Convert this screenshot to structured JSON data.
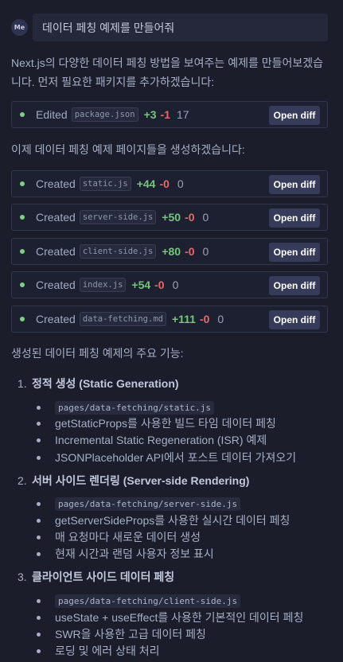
{
  "user": {
    "avatar": "Me",
    "message": "데이터 페칭 예제를 만들어줘"
  },
  "intro": "Next.js의 다양한 데이터 페칭 방법을 보여주는 예제를 만들어보겠습니다. 먼저 필요한 패키지를 추가하겠습니다:",
  "edit_card": {
    "verb": "Edited",
    "file": "package.json",
    "added": "+3",
    "removed": "-1",
    "count": "17",
    "button": "Open diff"
  },
  "create_intro": "이제 데이터 페칭 예제 페이지들을 생성하겠습니다:",
  "created_cards": [
    {
      "verb": "Created",
      "file": "static.js",
      "added": "+44",
      "removed": "-0",
      "count": "0",
      "button": "Open diff"
    },
    {
      "verb": "Created",
      "file": "server-side.js",
      "added": "+50",
      "removed": "-0",
      "count": "0",
      "button": "Open diff"
    },
    {
      "verb": "Created",
      "file": "client-side.js",
      "added": "+80",
      "removed": "-0",
      "count": "0",
      "button": "Open diff"
    },
    {
      "verb": "Created",
      "file": "index.js",
      "added": "+54",
      "removed": "-0",
      "count": "0",
      "button": "Open diff"
    },
    {
      "verb": "Created",
      "file": "data-fetching.md",
      "added": "+111",
      "removed": "-0",
      "count": "0",
      "button": "Open diff"
    }
  ],
  "features_heading": "생성된 데이터 페칭 예제의 주요 기능:",
  "sections": [
    {
      "num": "1.",
      "title": "정적 생성 (Static Generation)",
      "code": "pages/data-fetching/static.js",
      "bullets": [
        "getStaticProps를 사용한 빌드 타임 데이터 페칭",
        "Incremental Static Regeneration (ISR) 예제",
        "JSONPlaceholder API에서 포스트 데이터 가져오기"
      ]
    },
    {
      "num": "2.",
      "title": "서버 사이드 렌더링 (Server-side Rendering)",
      "code": "pages/data-fetching/server-side.js",
      "bullets": [
        "getServerSideProps를 사용한 실시간 데이터 페칭",
        "매 요청마다 새로운 데이터 생성",
        "현재 시간과 랜덤 사용자 정보 표시"
      ]
    },
    {
      "num": "3.",
      "title": "클라이언트 사이드 데이터 페칭",
      "code": "pages/data-fetching/client-side.js",
      "bullets": [
        "useState + useEffect를 사용한 기본적인 데이터 페칭",
        "SWR을 사용한 고급 데이터 페칭",
        "로딩 및 에러 상태 처리"
      ]
    }
  ]
}
